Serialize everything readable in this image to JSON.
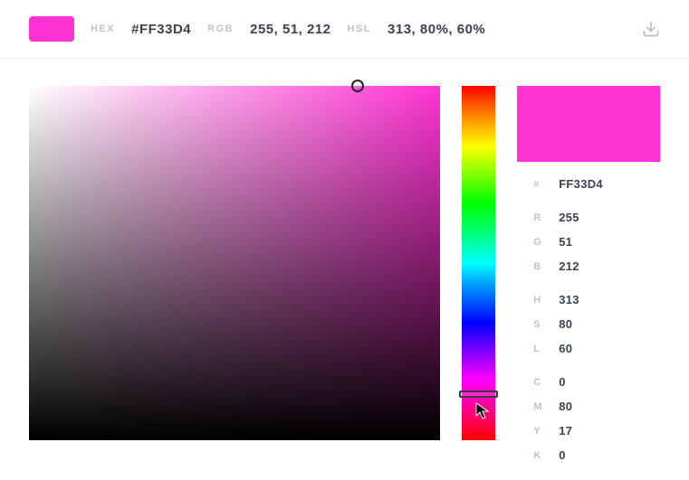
{
  "color": "#FF33D4",
  "header": {
    "hex_label": "HEX",
    "hex_value": "#FF33D4",
    "rgb_label": "RGB",
    "rgb_value": "255, 51, 212",
    "hsl_label": "HSL",
    "hsl_value": "313, 80%, 60%"
  },
  "hue_handle_top_pct": 87,
  "sv_handle": {
    "left_pct": 80,
    "top_pct": 0
  },
  "info": {
    "hash": "#",
    "hex": "FF33D4",
    "r_label": "R",
    "r": "255",
    "g_label": "G",
    "g": "51",
    "b_label": "B",
    "b": "212",
    "h_label": "H",
    "h": "313",
    "s_label": "S",
    "s": "80",
    "l_label": "L",
    "l": "60",
    "c_label": "C",
    "c": "0",
    "m_label": "M",
    "m": "80",
    "y_label": "Y",
    "y": "17",
    "k_label": "K",
    "k": "0"
  }
}
